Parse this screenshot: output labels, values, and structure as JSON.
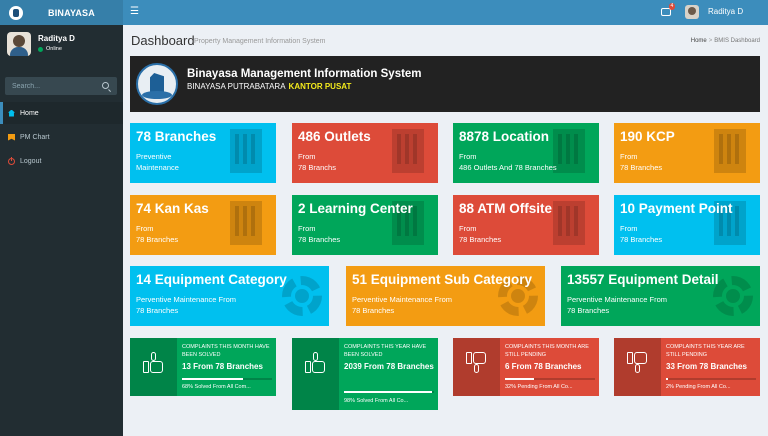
{
  "app": {
    "title": "BINAYASA"
  },
  "topbar": {
    "menu_icon": "hamburger-icon",
    "notif_icon": "envelope-icon",
    "notif_count": "4",
    "username": "Raditya D"
  },
  "sidebar": {
    "user": {
      "name": "Raditya D",
      "status": "Online"
    },
    "search": {
      "placeholder": "Search..."
    },
    "items": [
      {
        "label": "Home",
        "icon": "home-icon",
        "active": true
      },
      {
        "label": "PM Chart",
        "icon": "bookmark-icon",
        "active": false
      },
      {
        "label": "Logout",
        "icon": "power-icon",
        "active": false
      }
    ]
  },
  "header": {
    "title": "Dashboard",
    "subtitle": "Property Management Information System",
    "breadcrumb": [
      "Home",
      "BMIS Dashboard"
    ]
  },
  "banner": {
    "title": "Binayasa Management Information System",
    "sub": "BINAYASA PUTRABATARA",
    "sub_highlight": "KANTOR PUSAT"
  },
  "colors": {
    "aqua": "#00c0ef",
    "red": "#dd4b39",
    "green": "#00a65a",
    "orange": "#f39c12",
    "header": "#3c8dbc",
    "sidebar": "#222d32"
  },
  "stats": [
    {
      "title": "78 Branches",
      "line1": "Preventive",
      "line2": "Maintenance",
      "color": "aqua"
    },
    {
      "title": "486 Outlets",
      "line1": "From",
      "line2": "78 Branchs",
      "color": "red"
    },
    {
      "title": "8878 Location",
      "line1": "From",
      "line2": "486 Outlets And 78 Branches",
      "color": "green"
    },
    {
      "title": "190 KCP",
      "line1": "From",
      "line2": "78 Branches",
      "color": "orange"
    },
    {
      "title": "74 Kan Kas",
      "line1": "From",
      "line2": "78 Branches",
      "color": "orange"
    },
    {
      "title": "2 Learning Center",
      "line1": "From",
      "line2": "78 Branches",
      "color": "green"
    },
    {
      "title": "88 ATM Offsite",
      "line1": "From",
      "line2": "78 Branches",
      "color": "red"
    },
    {
      "title": "10 Payment Point",
      "line1": "From",
      "line2": "78 Branches",
      "color": "aqua"
    }
  ],
  "equipment": [
    {
      "title": "14 Equipment Category",
      "line1": "Perventive Maintenance From",
      "line2": "78 Branches",
      "color": "aqua"
    },
    {
      "title": "51 Equipment Sub Category",
      "line1": "Perventive Maintenance From",
      "line2": "78 Branches",
      "color": "orange"
    },
    {
      "title": "13557 Equipment Detail",
      "line1": "Perventive Maintenance From",
      "line2": "78 Branches",
      "color": "green"
    }
  ],
  "complaints": [
    {
      "heading": "COMPLAINTS THIS MONTH HAVE BEEN SOLVED",
      "count": "13 From 78 Branches",
      "desc": "68% Solved From All Com...",
      "progress": 0.68,
      "color": "green",
      "icon": "thumbs-up-icon"
    },
    {
      "heading": "COMPLAINTS THIS YEAR HAVE BEEN SOLVED",
      "count": "2039 From 78 Branches",
      "desc": "98% Solved From All Co...",
      "progress": 0.98,
      "color": "green",
      "icon": "thumbs-up-icon"
    },
    {
      "heading": "COMPLAINTS THIS MONTH ARE STILL PENDING",
      "count": "6 From 78 Branches",
      "desc": "32% Pending From All Co...",
      "progress": 0.32,
      "color": "red",
      "icon": "thumbs-down-icon"
    },
    {
      "heading": "COMPLAINTS THIS YEAR ARE STILL PENDING",
      "count": "33 From 78 Branches",
      "desc": "2% Pending From All Co...",
      "progress": 0.02,
      "color": "red",
      "icon": "thumbs-down-icon"
    }
  ]
}
